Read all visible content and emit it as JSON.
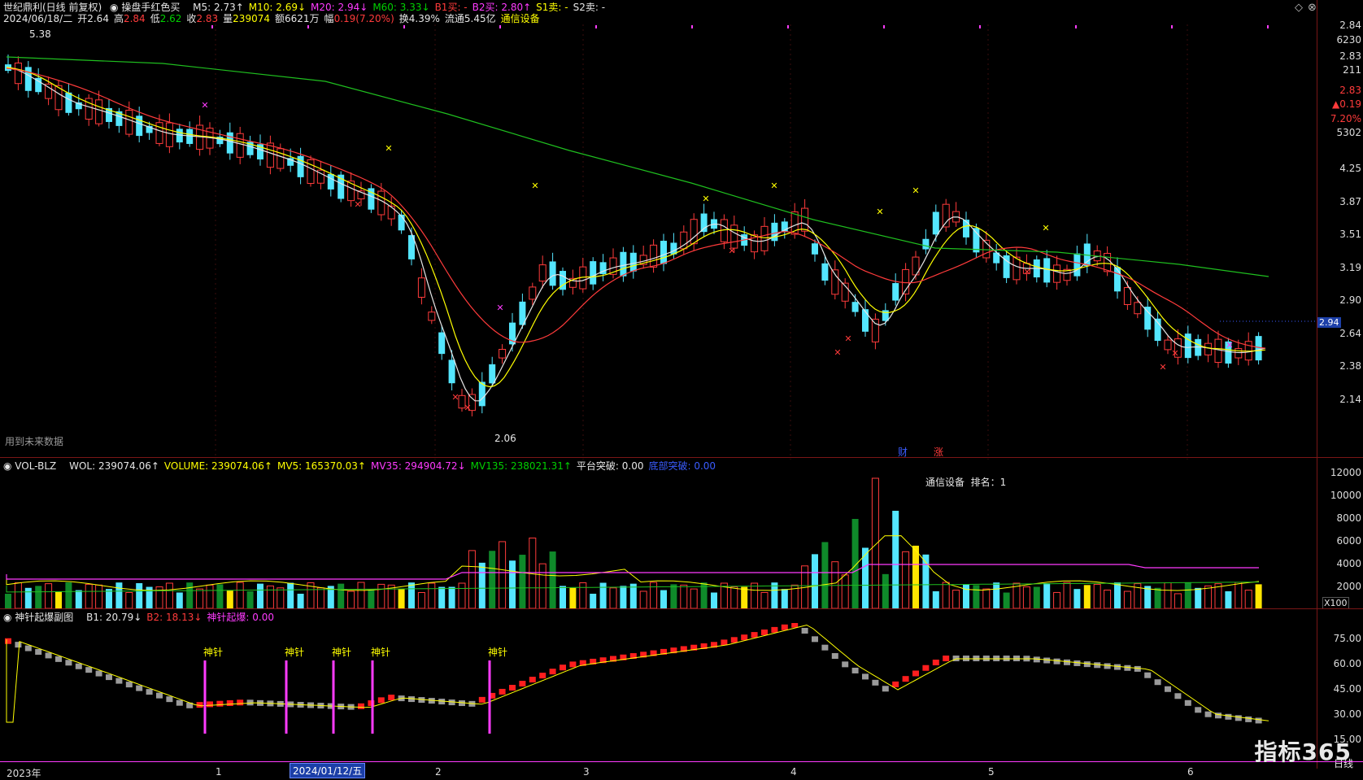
{
  "header": {
    "stock": "世纪鼎利(日线 前复权)",
    "indicator_name": "操盘手红色买",
    "ma": [
      {
        "label": "M5: 2.73",
        "arrow": "↑",
        "color": "#e6e6e6"
      },
      {
        "label": "M10: 2.69",
        "arrow": "↓",
        "color": "#ffff00"
      },
      {
        "label": "M20: 2.94",
        "arrow": "↓",
        "color": "#ff3bff"
      },
      {
        "label": "M60: 3.33",
        "arrow": "↓",
        "color": "#00d000"
      },
      {
        "label": "B1买: -",
        "arrow": "",
        "color": "#ff3b3b"
      },
      {
        "label": "B2买: 2.80",
        "arrow": "↑",
        "color": "#ff3bff"
      },
      {
        "label": "S1卖: -",
        "arrow": "",
        "color": "#ffff00"
      },
      {
        "label": "S2卖: -",
        "arrow": "",
        "color": "#e6e6e6"
      }
    ],
    "line2": {
      "date": "2024/06/18/二",
      "open_label": "开",
      "open": "2.64",
      "high_label": "高",
      "high": "2.84",
      "low_label": "低",
      "low": "2.62",
      "close_label": "收",
      "close": "2.83",
      "vol_label": "量",
      "vol": "239074",
      "amt_label": "额",
      "amt": "6621万",
      "chg_label": "幅",
      "chg": "0.19(7.20%)",
      "turnover": "换4.39%",
      "float": "流通5.45亿",
      "industry": "通信设备"
    }
  },
  "main_chart": {
    "notes": {
      "hi": "5.38",
      "lo": "2.06",
      "future": "用到未来数据"
    },
    "badges": {
      "cai": "财",
      "zhang": "涨"
    }
  },
  "price_axis": {
    "quote": [
      "2.84",
      "6230",
      "2.83",
      "211",
      "2.83",
      "▲0.19",
      "7.20%",
      "5302"
    ],
    "ticks": [
      "4.25",
      "3.87",
      "3.51",
      "3.19",
      "2.90",
      "2.64",
      "2.38",
      "2.14"
    ],
    "current": "2.94"
  },
  "vol_header": {
    "name": "VOL-BLZ",
    "items": [
      {
        "label": "WOL: 239074.06",
        "arrow": "↑",
        "color": "#e6e6e6"
      },
      {
        "label": "VOLUME: 239074.06",
        "arrow": "↑",
        "color": "#ffff00"
      },
      {
        "label": "MV5: 165370.03",
        "arrow": "↑",
        "color": "#ffff00"
      },
      {
        "label": "MV35: 294904.72",
        "arrow": "↓",
        "color": "#ff3bff"
      },
      {
        "label": "MV135: 238021.31",
        "arrow": "↑",
        "color": "#00d000"
      },
      {
        "label": "平台突破: 0.00",
        "arrow": "",
        "color": "#e6e6e6"
      },
      {
        "label": "底部突破: 0.00",
        "arrow": "",
        "color": "#3a5cff"
      }
    ],
    "note": "通信设备  排名：1",
    "ticks": [
      "12000",
      "10000",
      "8000",
      "6000",
      "4000",
      "2000"
    ],
    "unit": "X100"
  },
  "osc_header": {
    "name": "神针起爆副图",
    "items": [
      {
        "label": "B1: 20.79",
        "arrow": "↓",
        "color": "#e6e6e6"
      },
      {
        "label": "B2: 18.13",
        "arrow": "↓",
        "color": "#ff3b3b"
      },
      {
        "label": "神针起爆: 0.00",
        "arrow": "",
        "color": "#ff3bff"
      }
    ],
    "needle_label": "神针",
    "ticks": [
      "75.00",
      "60.00",
      "45.00",
      "30.00",
      "15.00"
    ],
    "period": "日线"
  },
  "x_axis": {
    "year": "2023年",
    "months": [
      "1",
      "2",
      "3",
      "4",
      "5",
      "6"
    ],
    "highlight": "2024/01/12/五"
  },
  "logo": "指标365"
}
